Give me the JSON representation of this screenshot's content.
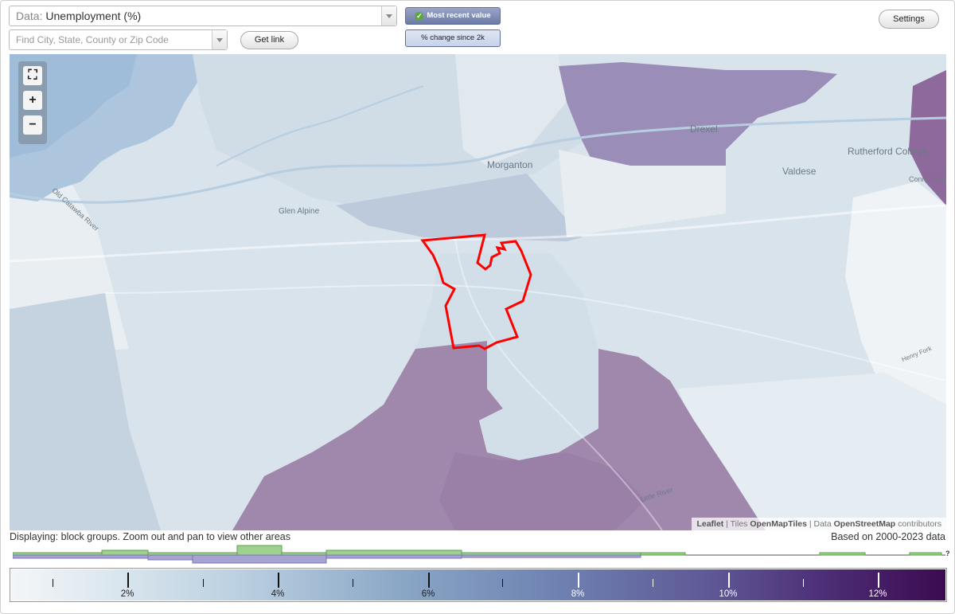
{
  "controls": {
    "data_prefix": "Data:",
    "data_value": "Unemployment (%)",
    "search_placeholder": "Find City, State, County or Zip Code",
    "get_link": "Get link",
    "most_recent": "Most recent value",
    "pct_change": "% change since 2k",
    "settings": "Settings"
  },
  "map": {
    "labels": [
      "Morganton",
      "Drexel",
      "Valdese",
      "Rutherford College",
      "Glen Alpine",
      "Old Catawba River",
      "Little River",
      "Henry Fork",
      "Connelly Springs"
    ],
    "attribution": {
      "leaflet": "Leaflet",
      "sep1": " | Tiles ",
      "tiles": "OpenMapTiles",
      "sep2": " | Data ",
      "data": "OpenStreetMap",
      "contrib": " contributors"
    },
    "zoom": {
      "fit": "⛶",
      "in": "+",
      "out": "−"
    }
  },
  "status": "Displaying: block groups. Zoom out and pan to view other areas",
  "based_on": "Based on 2000-2023 data",
  "histogram_help": "?",
  "legend": {
    "labels": [
      "2%",
      "4%",
      "6%",
      "8%",
      "10%",
      "12%"
    ]
  },
  "colors": {
    "highlight": "#ff0000",
    "low": "#f3f6f9",
    "mid": "#8aa6c6",
    "high": "#3b0a50",
    "histo_above": "#9fd18e",
    "histo_below": "#a6a3d2"
  }
}
